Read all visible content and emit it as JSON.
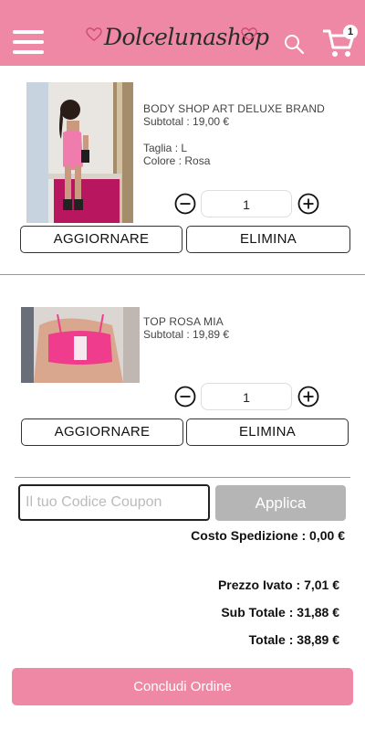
{
  "header": {
    "brand": "Dolcelunashop",
    "cart_count": "1",
    "accent_color": "#ee88a5"
  },
  "cart": {
    "items": [
      {
        "name": "BODY SHOP ART DELUXE BRAND",
        "subtotal": "Subtotal : 19,00 €",
        "size": "Taglia : L",
        "color": "Colore : Rosa",
        "quantity": "1",
        "update_label": "AGGIORNARE",
        "remove_label": "ELIMINA"
      },
      {
        "name": "TOP ROSA MIA",
        "subtotal": "Subtotal : 19,89 €",
        "quantity": "1",
        "update_label": "AGGIORNARE",
        "remove_label": "ELIMINA"
      }
    ]
  },
  "coupon": {
    "placeholder": "Il tuo Codice Coupon",
    "apply_label": "Applica"
  },
  "summary": {
    "shipping": "Costo Spedizione : 0,00 €",
    "vat": "Prezzo Ivato : 7,01 €",
    "subtotal": "Sub Totale : 31,88 €",
    "total": "Totale : 38,89 €"
  },
  "checkout_label": "Concludi Ordine"
}
